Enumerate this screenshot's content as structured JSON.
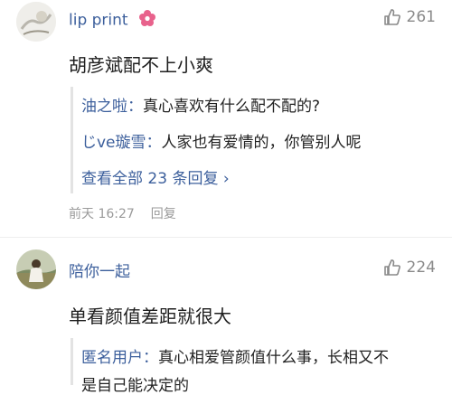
{
  "comments": [
    {
      "username": "lip print",
      "badge_icon": "flower-icon",
      "likes": "261",
      "text": "胡彦斌配不上小爽",
      "replies": [
        {
          "name": "油之啦：",
          "text": "真心喜欢有什么配不配的?"
        },
        {
          "name": "じve璇雪：",
          "text": "人家也有爱情的，你管别人呢"
        }
      ],
      "view_all": "查看全部 23 条回复 ›",
      "time": "前天 16:27",
      "reply_label": "回复"
    },
    {
      "username": "陪你一起",
      "likes": "224",
      "text": "单看颜值差距就很大",
      "replies": [
        {
          "name": "匿名用户：",
          "text": "真心相爱管颜值什么事，长相又不",
          "continuation": "是自己能决定的"
        }
      ]
    }
  ],
  "colors": {
    "link": "#3c5f9c",
    "badge": "#e8628c",
    "meta": "#9a9a9a"
  }
}
